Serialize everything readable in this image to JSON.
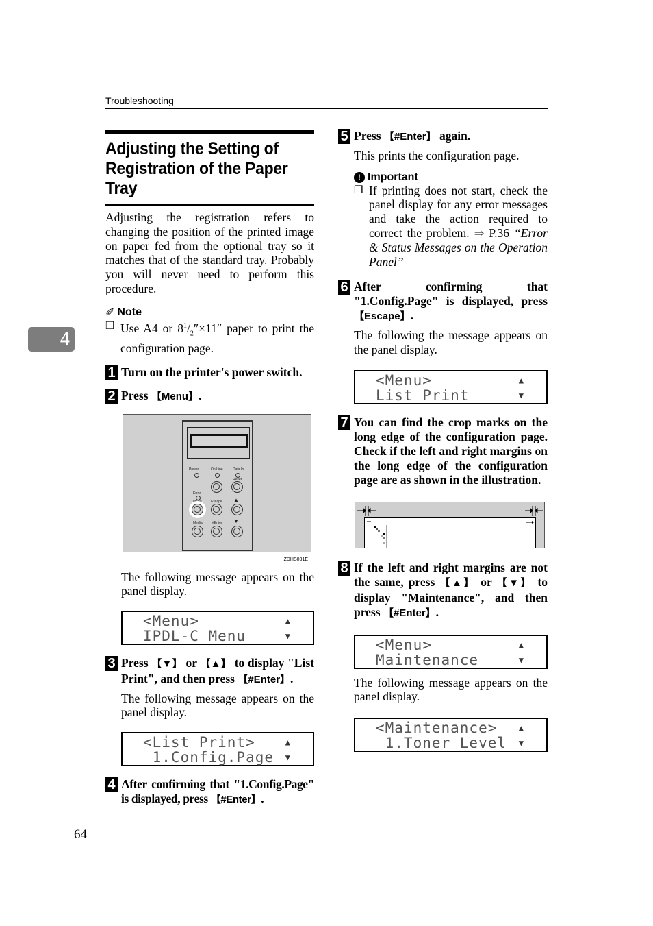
{
  "header": {
    "section": "Troubleshooting"
  },
  "chapter_tab": "4",
  "title": "Adjusting the Setting of Registration of the Paper Tray",
  "intro": "Adjusting the registration refers to changing the position of the printed image on paper fed from the optional tray so it matches that of the standard tray. Probably you will never need to perform this procedure.",
  "note": {
    "heading": "Note",
    "icon": "pencil-icon",
    "item_pre": "Use A4 or 8",
    "item_sup": "1",
    "item_mid": "/",
    "item_sub": "2",
    "item_post": "″×11″ paper to print the configuration page."
  },
  "steps": [
    {
      "num": "1",
      "text": "Turn on the printer's power switch."
    },
    {
      "num": "2",
      "text_pre": "Press ",
      "key": "Menu",
      "text_post": ".",
      "figure": {
        "code": "ZDHS031E",
        "labels": {
          "power": "Power",
          "online": "On Line",
          "datain": "Data In",
          "reset": "Reset",
          "error": "Error",
          "menu": "Menu",
          "escape": "Escape",
          "media": "Media",
          "enter": "Enter"
        },
        "highlighted_button": "Menu"
      },
      "after": "The following message appears on the panel display.",
      "lcd": {
        "line1": "<Menu>",
        "line2": "IPDL-C Menu"
      }
    },
    {
      "num": "3",
      "text_pre": "Press ",
      "key1": "▼",
      "text_mid1": " or ",
      "key2": "▲",
      "text_mid2": " to display \"List Print\", and then press ",
      "key3": "#Enter",
      "text_post": ".",
      "after": "The following message appears on the panel display.",
      "lcd": {
        "line1": "<List Print>",
        "line2": " 1.Config.Page"
      }
    },
    {
      "num": "4",
      "text_pre": "After confirming that \"1.Config.Page\" is displayed, press ",
      "key": "#Enter",
      "text_post": "."
    },
    {
      "num": "5",
      "text_pre": "Press ",
      "key": "#Enter",
      "text_post": " again.",
      "after": "This prints the configuration page.",
      "important": {
        "heading": "Important",
        "icon": "warning-gear-icon",
        "item": "If printing does not start, check the panel display for any error messages and take the action required to correct the problem.",
        "ref_arrow": "⇒ P.36 ",
        "ref_title": "“Error & Status Messages on the Operation Panel”"
      }
    },
    {
      "num": "6",
      "text_pre": "After confirming that \"1.Config.Page\" is displayed, press ",
      "key": "Escape",
      "text_post": ".",
      "after": "The following the message appears on the panel display.",
      "lcd": {
        "line1": "<Menu>",
        "line2": "List Print"
      }
    },
    {
      "num": "7",
      "text": "You can find the crop marks on the long edge of the configuration page. Check if the left and right margins on the long edge of the configuration page are as shown in the illustration."
    },
    {
      "num": "8",
      "text_pre": "If the left and right margins are not the same, press ",
      "key1": "▲",
      "text_mid1": " or ",
      "key2": "▼",
      "text_mid2": " to display \"Maintenance\", and then press ",
      "key3": "#Enter",
      "text_post": ".",
      "lcd": {
        "line1": "<Menu>",
        "line2": "Maintenance"
      },
      "after": "The following message appears on the panel display.",
      "lcd2": {
        "line1": "<Maintenance>",
        "line2": " 1.Toner Level"
      }
    }
  ],
  "lcd_arrows": {
    "up": "▲",
    "down": "▼"
  },
  "page_number": "64"
}
